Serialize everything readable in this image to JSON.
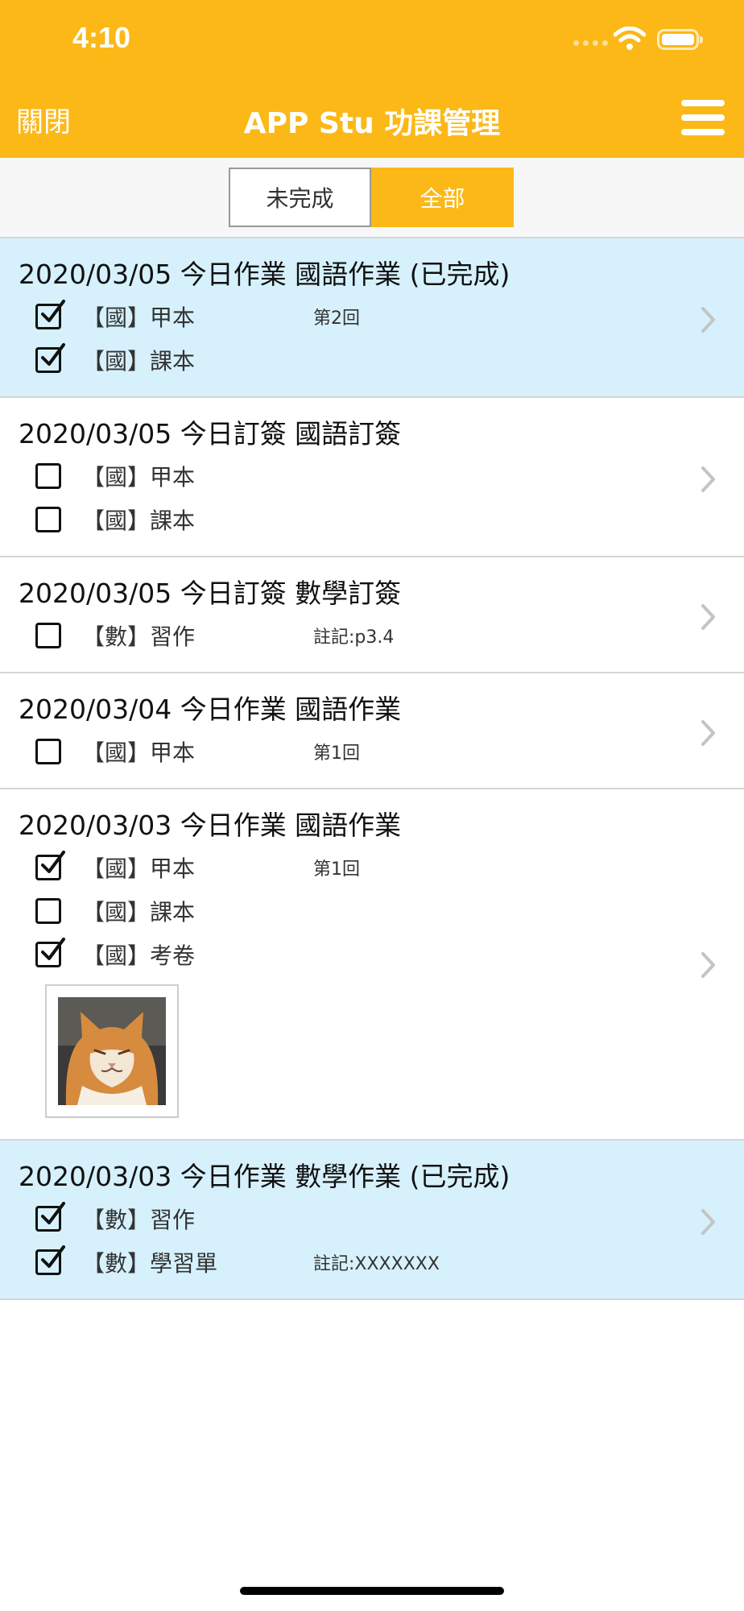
{
  "status": {
    "time": "4:10"
  },
  "nav": {
    "close_label": "關閉",
    "title": "APP Stu 功課管理"
  },
  "filter": {
    "options": [
      "未完成",
      "全部"
    ],
    "selected": "全部"
  },
  "cards": [
    {
      "title": "2020/03/05 今日作業 國語作業 (已完成)",
      "completed": true,
      "items": [
        {
          "checked": true,
          "label": "【國】甲本",
          "note": "第2回"
        },
        {
          "checked": true,
          "label": "【國】課本",
          "note": ""
        }
      ]
    },
    {
      "title": "2020/03/05 今日訂簽 國語訂簽",
      "completed": false,
      "items": [
        {
          "checked": false,
          "label": "【國】甲本",
          "note": ""
        },
        {
          "checked": false,
          "label": "【國】課本",
          "note": ""
        }
      ]
    },
    {
      "title": "2020/03/05 今日訂簽 數學訂簽",
      "completed": false,
      "items": [
        {
          "checked": false,
          "label": "【數】習作",
          "note": "註記:p3.4"
        }
      ]
    },
    {
      "title": "2020/03/04 今日作業 國語作業",
      "completed": false,
      "items": [
        {
          "checked": false,
          "label": "【國】甲本",
          "note": "第1回"
        }
      ]
    },
    {
      "title": "2020/03/03 今日作業 國語作業",
      "completed": false,
      "has_photo": true,
      "items": [
        {
          "checked": true,
          "label": "【國】甲本",
          "note": "第1回"
        },
        {
          "checked": false,
          "label": "【國】課本",
          "note": ""
        },
        {
          "checked": true,
          "label": "【國】考卷",
          "note": ""
        }
      ]
    },
    {
      "title": "2020/03/03 今日作業 數學作業 (已完成)",
      "completed": true,
      "items": [
        {
          "checked": true,
          "label": "【數】習作",
          "note": ""
        },
        {
          "checked": true,
          "label": "【數】學習單",
          "note": "註記:XXXXXXX"
        }
      ]
    }
  ],
  "colors": {
    "brand": "#FBB817",
    "completed_bg": "#D6F1FC",
    "text": "#111111"
  },
  "icons": {
    "menu": "hamburger-menu-icon",
    "chevron": "chevron-right-icon",
    "checkbox": "checkbox-icon",
    "photo": "cat-photo-thumbnail"
  }
}
